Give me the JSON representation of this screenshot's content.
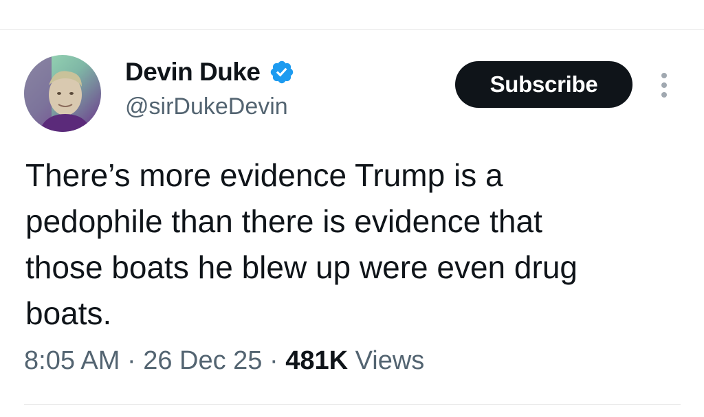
{
  "author": {
    "display_name": "Devin Duke",
    "handle": "@sirDukeDevin",
    "verified": true,
    "avatar_icon": "profile-photo-avatar"
  },
  "actions": {
    "subscribe_label": "Subscribe",
    "more_icon": "more-vertical-icon"
  },
  "tweet": {
    "text": "There’s more evidence Trump is a\npedophile than there is evidence that\nthose boats he blew up were even drug\nboats."
  },
  "meta": {
    "time": "8:05 AM",
    "separator1": " · ",
    "date": "26 Dec 25",
    "separator2": " · ",
    "views_count": "481K",
    "views_label": " Views"
  },
  "colors": {
    "verified_blue": "#1d9bf0",
    "text_primary": "#0f1419",
    "text_secondary": "#536471",
    "button_bg": "#0f1419"
  }
}
